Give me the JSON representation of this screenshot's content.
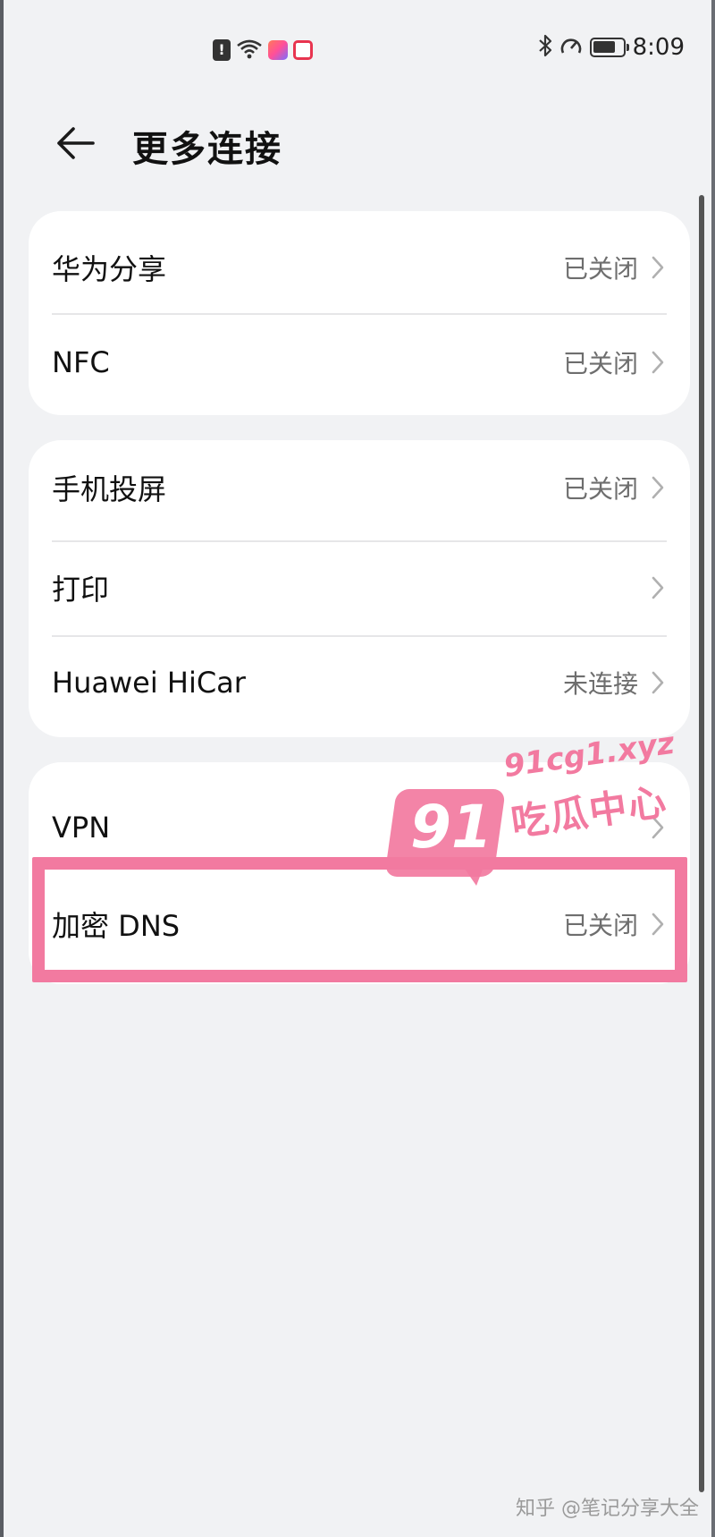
{
  "status_bar": {
    "time": "8:09",
    "left_icons": [
      "sim-alert-icon",
      "wifi-icon",
      "app-icon-a",
      "app-icon-b"
    ],
    "right_icons": [
      "bluetooth-icon",
      "speedometer-icon",
      "battery-icon"
    ]
  },
  "header": {
    "title": "更多连接",
    "back_icon": "arrow-left-icon"
  },
  "groups": [
    {
      "rows": [
        {
          "label": "华为分享",
          "status": "已关闭"
        },
        {
          "label": "NFC",
          "status": "已关闭"
        }
      ]
    },
    {
      "rows": [
        {
          "label": "手机投屏",
          "status": "已关闭"
        },
        {
          "label": "打印",
          "status": ""
        },
        {
          "label": "Huawei HiCar",
          "status": "未连接"
        }
      ]
    },
    {
      "rows": [
        {
          "label": "VPN",
          "status": ""
        },
        {
          "label": "加密 DNS",
          "status": "已关闭"
        }
      ]
    }
  ],
  "watermark": {
    "number": "91",
    "url": "91cg1.xyz",
    "name": "吃瓜中心"
  },
  "footer_watermark": "知乎 @笔记分享大全",
  "colors": {
    "background": "#f1f2f4",
    "card": "#ffffff",
    "highlight": "#f27aa0",
    "secondary_text": "#6e6e6e"
  }
}
